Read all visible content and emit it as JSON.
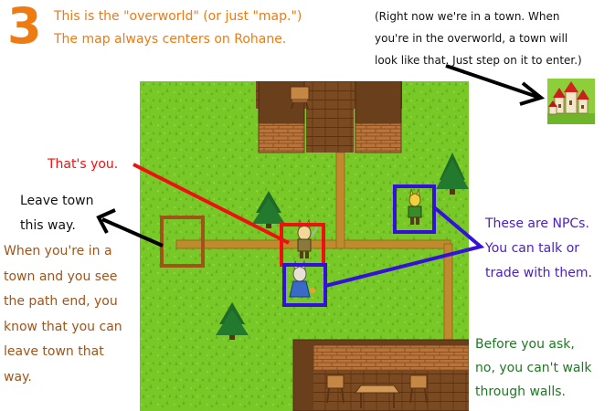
{
  "step_number": "3",
  "intro": {
    "line1": "This is the \"overworld\" (or just \"map.\")",
    "line2": "The map always centers on Rohane."
  },
  "town_note": {
    "line1": "(Right now we're in a town. When",
    "line2": "you're in the overworld, a town will",
    "line3": "look like that. Just step on it to enter.)"
  },
  "you_label": "That's you.",
  "leave_label": {
    "line1": "Leave town",
    "line2": "this way."
  },
  "path_note": {
    "line1": "When you're in a",
    "line2": "town and you see",
    "line3": "the path end, you",
    "line4": "know that you can",
    "line5": "leave town that",
    "line6": "way."
  },
  "npc_note": {
    "line1": "These are NPCs.",
    "line2": "You can talk or",
    "line3": "trade with them."
  },
  "walls_note": {
    "line1": "Before you ask,",
    "line2": "no, you can't walk",
    "line3": "through walls."
  },
  "colors": {
    "orange": "#ee7a12",
    "brown_text": "#a0541a",
    "red": "#ee1111",
    "blue": "#3311dd",
    "purple_text": "#4a1cc8",
    "green_text": "#1d7a22",
    "grass": "#78c828",
    "path": "#c08a2e",
    "wood": "#7a4a22"
  }
}
